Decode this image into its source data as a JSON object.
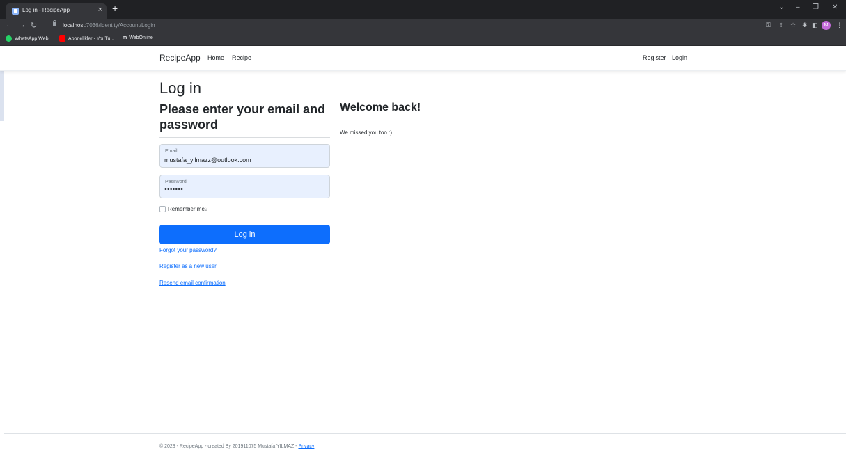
{
  "browser": {
    "tab_title": "Log in - RecipeApp",
    "tab_close": "×",
    "new_tab": "+",
    "url_host": "localhost",
    "url_rest": ":7036/Identity/Account/Login",
    "avatar_letter": "M",
    "bookmarks": [
      {
        "label": "WhatsApp Web",
        "color": "#25d366"
      },
      {
        "label": "Abonelikler - YouTu...",
        "color": "#ff0000"
      },
      {
        "label": "WebOnline",
        "color": "#ffffff"
      }
    ],
    "window_controls": [
      "⌄",
      "–",
      "❐",
      "✕"
    ]
  },
  "navbar": {
    "brand": "RecipeApp",
    "links": [
      "Home",
      "Recipe"
    ],
    "right_links": [
      "Register",
      "Login"
    ]
  },
  "login": {
    "title": "Log in",
    "subtitle": "Please enter your email and password",
    "email_label": "Email",
    "email_value": "mustafa_yilmazz@outlook.com",
    "password_label": "Password",
    "password_value": "•••••••",
    "remember_label": "Remember me?",
    "submit_label": "Log in",
    "forgot_link": "Forgot your password?",
    "register_link": "Register as a new user",
    "resend_link": "Resend email confirmation"
  },
  "side": {
    "welcome": "Welcome back!",
    "message": "We missed you too :)"
  },
  "footer": {
    "text": "© 2023 - RecipeApp - created By 201911075 Mustafa YILMAZ - ",
    "privacy": "Privacy"
  },
  "colors": {
    "primary": "#0d6efd",
    "autofill_bg": "#e8f0fe",
    "chrome_dark": "#202124"
  }
}
